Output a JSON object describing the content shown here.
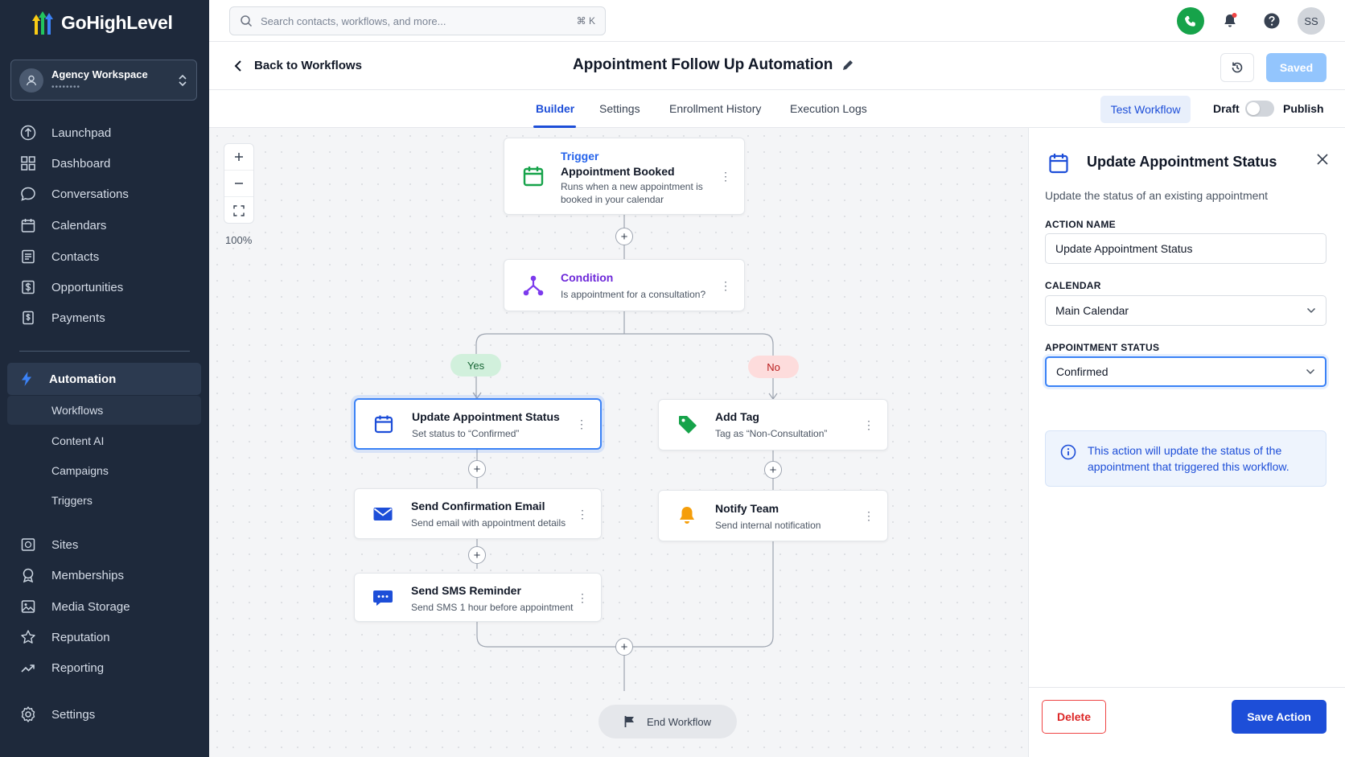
{
  "brand": {
    "name": "GoHighLevel"
  },
  "workspace": {
    "name": "Agency Workspace",
    "sub": "••••••••"
  },
  "sidebar": {
    "items": [
      {
        "label": "Launchpad"
      },
      {
        "label": "Dashboard"
      },
      {
        "label": "Conversations"
      },
      {
        "label": "Calendars"
      },
      {
        "label": "Contacts"
      },
      {
        "label": "Opportunities"
      },
      {
        "label": "Payments"
      }
    ],
    "automation": {
      "label": "Automation",
      "sub": [
        "Workflows",
        "Content AI",
        "Campaigns",
        "Triggers"
      ]
    },
    "bottom_items": [
      {
        "label": "Sites"
      },
      {
        "label": "Memberships"
      },
      {
        "label": "Media Storage"
      },
      {
        "label": "Reputation"
      },
      {
        "label": "Reporting"
      }
    ],
    "settings": "Settings"
  },
  "topbar": {
    "search_placeholder": "Search contacts, workflows, and more...",
    "shortcut": "⌘ K",
    "avatar": "SS"
  },
  "workflow": {
    "back_label": "Back to Workflows",
    "title": "Appointment Follow Up Automation",
    "saved_label": "Saved"
  },
  "tabs": [
    {
      "label": "Builder",
      "active": true
    },
    {
      "label": "Settings"
    },
    {
      "label": "Enrollment History"
    },
    {
      "label": "Execution Logs"
    }
  ],
  "actions": {
    "test": "Test Workflow",
    "draft": "Draft",
    "publish": "Publish"
  },
  "canvas": {
    "zoom_level": "100%",
    "trigger": {
      "kind": "Trigger",
      "title": "Appointment Booked",
      "desc": "Runs when a new appointment is booked in your calendar"
    },
    "condition": {
      "kind": "Condition",
      "desc": "Is appointment for a consultation?"
    },
    "yes_label": "Yes",
    "no_label": "No",
    "yes_branch": [
      {
        "title": "Update Appointment Status",
        "desc": "Set status to “Confirmed”"
      },
      {
        "title": "Send Confirmation Email",
        "desc": "Send email with appointment details"
      },
      {
        "title": "Send SMS Reminder",
        "desc": "Send SMS 1 hour before appointment"
      }
    ],
    "no_branch": [
      {
        "title": "Add Tag",
        "desc": "Tag as “Non-Consultation”"
      },
      {
        "title": "Notify Team",
        "desc": "Send internal notification"
      }
    ],
    "end_label": "End Workflow"
  },
  "panel": {
    "title": "Update Appointment Status",
    "desc": "Update the status of an existing appointment",
    "action_name_label": "ACTION NAME",
    "action_name_value": "Update Appointment Status",
    "calendar_label": "CALENDAR",
    "calendar_value": "Main Calendar",
    "status_label": "APPOINTMENT STATUS",
    "status_value": "Confirmed",
    "info": "This action will update the status of the appointment that triggered this workflow.",
    "delete_label": "Delete",
    "save_label": "Save Action"
  },
  "colors": {
    "sidebar_bg": "#1e293b",
    "accent": "#1d4ed8",
    "phone": "#16a34a",
    "yes_pill": "#d1f0dc",
    "no_pill": "#fddcdc"
  }
}
